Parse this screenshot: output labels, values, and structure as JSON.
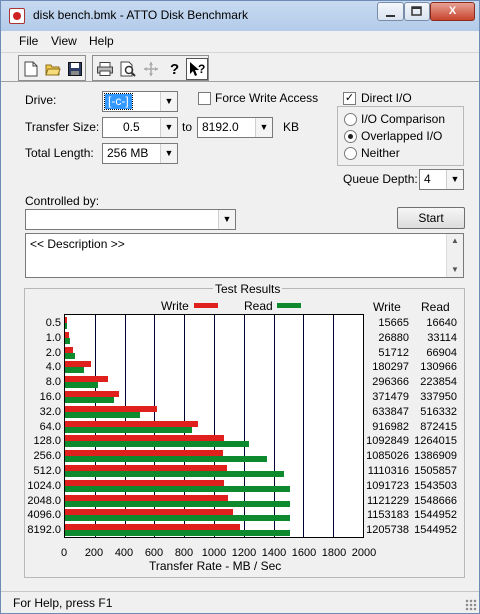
{
  "window": {
    "title": "disk bench.bmk - ATTO Disk Benchmark",
    "minimize_icon": "minimize-icon",
    "maximize_icon": "maximize-icon",
    "close_label": "X"
  },
  "menu": {
    "file": "File",
    "view": "View",
    "help": "Help"
  },
  "toolbar": {
    "icons": [
      "new-file-icon",
      "open-folder-icon",
      "save-icon",
      "print-icon",
      "print-preview-icon",
      "move-icon",
      "help-icon",
      "context-help-icon"
    ]
  },
  "form": {
    "drive_label": "Drive:",
    "drive_value": "[-c-]",
    "force_write_label": "Force Write Access",
    "force_write_checked": false,
    "direct_io_label": "Direct I/O",
    "direct_io_checked": true,
    "transfer_size_label": "Transfer Size:",
    "transfer_from": "0.5",
    "to_label": "to",
    "transfer_to": "8192.0",
    "kb_label": "KB",
    "total_length_label": "Total Length:",
    "total_length_value": "256 MB",
    "io_comparison_label": "I/O Comparison",
    "overlapped_io_label": "Overlapped I/O",
    "neither_label": "Neither",
    "selected_mode": "Overlapped I/O",
    "queue_depth_label": "Queue Depth:",
    "queue_depth_value": "4",
    "controlled_by_label": "Controlled by:",
    "controlled_by_value": "",
    "start_label": "Start",
    "description": "<< Description >>"
  },
  "results": {
    "title": "Test Results",
    "write_legend": "Write",
    "read_legend": "Read",
    "write_col": "Write",
    "read_col": "Read",
    "x_axis_label": "Transfer Rate - MB / Sec",
    "write_color": "#e0201c",
    "read_color": "#0e8a2e"
  },
  "chart_data": {
    "type": "bar",
    "title": "Test Results",
    "xlabel": "Transfer Rate - MB / Sec",
    "ylabel": "",
    "xlim": [
      0,
      2000
    ],
    "x_ticks": [
      "0",
      "200",
      "400",
      "600",
      "800",
      "1000",
      "1200",
      "1400",
      "1600",
      "1800",
      "2000"
    ],
    "categories": [
      "0.5",
      "1.0",
      "2.0",
      "4.0",
      "8.0",
      "16.0",
      "32.0",
      "64.0",
      "128.0",
      "256.0",
      "512.0",
      "1024.0",
      "2048.0",
      "4096.0",
      "8192.0"
    ],
    "series": [
      {
        "name": "Write",
        "values_kbps": [
          15665,
          26880,
          51712,
          180297,
          296366,
          371479,
          633847,
          916982,
          1092849,
          1085026,
          1110316,
          1091723,
          1121229,
          1153183,
          1205738
        ],
        "values_mbps": [
          15.3,
          26.3,
          50.5,
          176.1,
          289.4,
          362.8,
          619.0,
          895.5,
          1067.2,
          1059.6,
          1084.3,
          1066.1,
          1095.0,
          1126.2,
          1177.5
        ]
      },
      {
        "name": "Read",
        "values_kbps": [
          16640,
          33114,
          66904,
          130966,
          223854,
          337950,
          516332,
          872415,
          1264015,
          1386909,
          1505857,
          1543503,
          1548666,
          1544952,
          1544952
        ],
        "values_mbps": [
          16.3,
          32.3,
          65.3,
          127.9,
          218.6,
          330.0,
          504.2,
          852.0,
          1234.4,
          1354.4,
          1470.6,
          1507.3,
          1512.4,
          1508.7,
          1508.7
        ]
      }
    ],
    "legend": "top-center",
    "grid": true
  },
  "status": {
    "text": "For Help, press F1"
  }
}
